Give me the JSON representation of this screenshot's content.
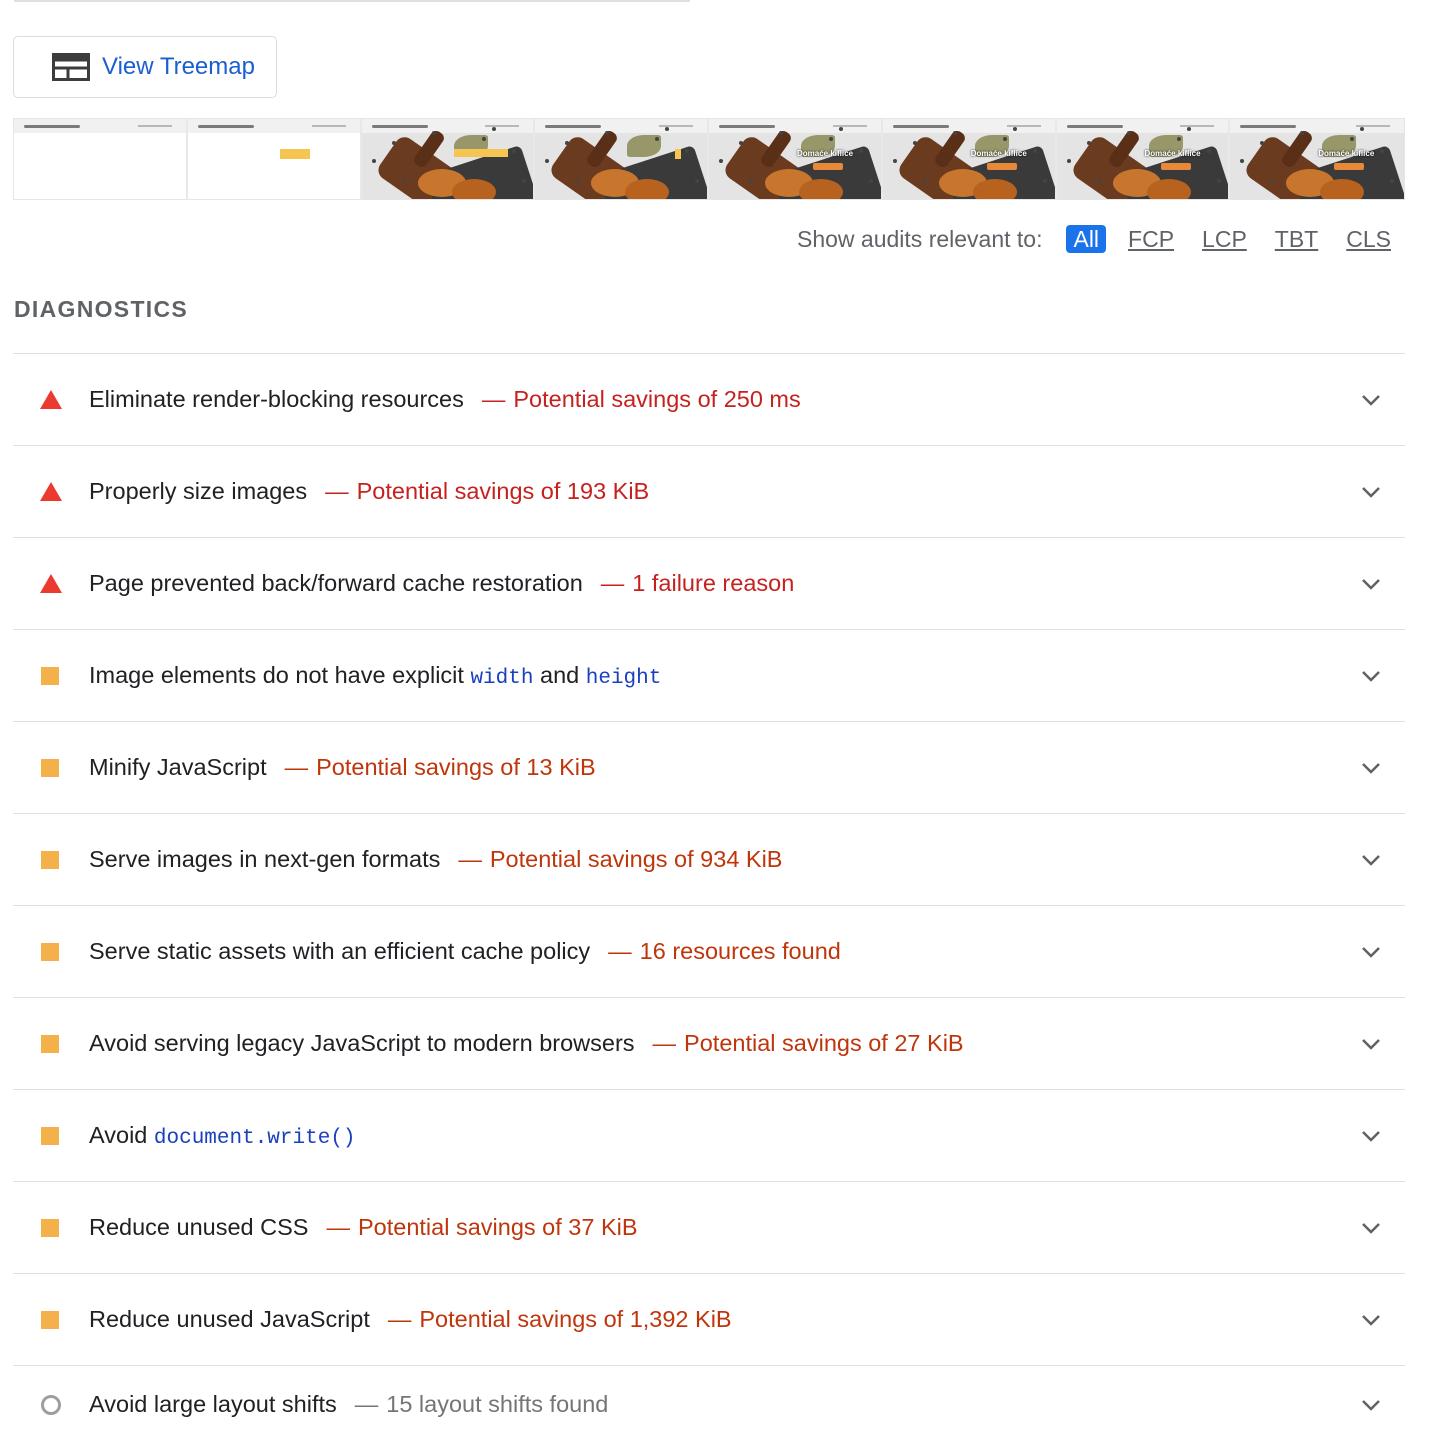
{
  "treemap": {
    "label": "View Treemap",
    "icon": "treemap-icon"
  },
  "filmstrip": {
    "frames": [
      {
        "kind": "blank"
      },
      {
        "kind": "placeholder"
      },
      {
        "kind": "photo",
        "title": ""
      },
      {
        "kind": "photo",
        "title": ""
      },
      {
        "kind": "photo",
        "title": "Domaće kiflice"
      },
      {
        "kind": "photo",
        "title": "Domaće kiflice"
      },
      {
        "kind": "photo",
        "title": "Domaće kiflice"
      },
      {
        "kind": "photo",
        "title": "Domaće kiflice"
      }
    ]
  },
  "filter": {
    "label": "Show audits relevant to:",
    "chips": [
      "All",
      "FCP",
      "LCP",
      "TBT",
      "CLS"
    ],
    "active": "All"
  },
  "section": {
    "title": "DIAGNOSTICS"
  },
  "colors": {
    "fail": "#eb3a2f",
    "average": "#f4b04a",
    "info": "#9e9e9e",
    "link": "#1a73e8"
  },
  "audits": [
    {
      "status": "fail",
      "title": "Eliminate render-blocking resources",
      "separator": "—",
      "detail": "Potential savings of 250 ms"
    },
    {
      "status": "fail",
      "title": "Properly size images",
      "separator": "—",
      "detail": "Potential savings of 193 KiB"
    },
    {
      "status": "fail",
      "title": "Page prevented back/forward cache restoration",
      "separator": "—",
      "detail": "1 failure reason"
    },
    {
      "status": "average",
      "title_parts": [
        "Image elements do not have explicit ",
        "width",
        " and ",
        "height"
      ],
      "separator": "",
      "detail": ""
    },
    {
      "status": "average",
      "title": "Minify JavaScript",
      "separator": "—",
      "detail": "Potential savings of 13 KiB"
    },
    {
      "status": "average",
      "title": "Serve images in next-gen formats",
      "separator": "—",
      "detail": "Potential savings of 934 KiB"
    },
    {
      "status": "average",
      "title": "Serve static assets with an efficient cache policy",
      "separator": "—",
      "detail": "16 resources found"
    },
    {
      "status": "average",
      "title": "Avoid serving legacy JavaScript to modern browsers",
      "separator": "—",
      "detail": "Potential savings of 27 KiB"
    },
    {
      "status": "average",
      "title_parts": [
        "Avoid ",
        "document.write()"
      ],
      "separator": "",
      "detail": ""
    },
    {
      "status": "average",
      "title": "Reduce unused CSS",
      "separator": "—",
      "detail": "Potential savings of 37 KiB"
    },
    {
      "status": "average",
      "title": "Reduce unused JavaScript",
      "separator": "—",
      "detail": "Potential savings of 1,392 KiB"
    },
    {
      "status": "info",
      "title": "Avoid large layout shifts",
      "separator": "—",
      "detail": "15 layout shifts found"
    }
  ]
}
